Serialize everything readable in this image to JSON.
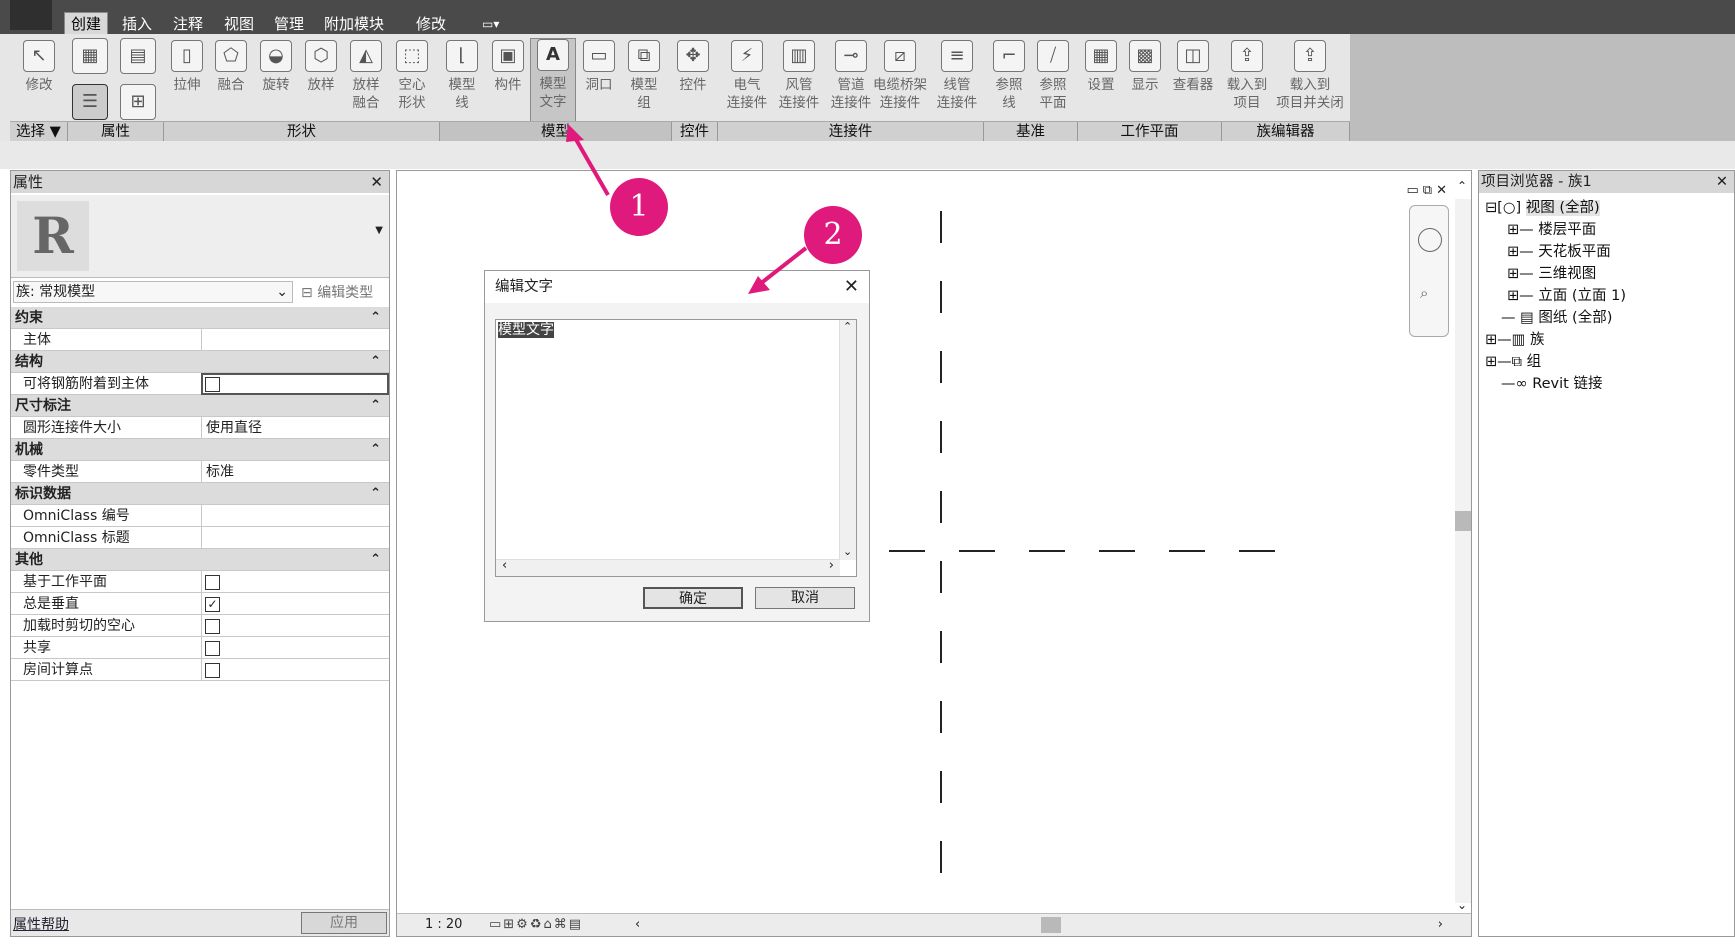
{
  "tabs": [
    "创建",
    "插入",
    "注释",
    "视图",
    "管理",
    "附加模块",
    "修改"
  ],
  "ribbon": {
    "tools": [
      {
        "label": "修改",
        "icon": "cursor-icon"
      },
      {
        "label": "拉伸",
        "icon": "extrude-icon"
      },
      {
        "label": "融合",
        "icon": "blend-icon"
      },
      {
        "label": "旋转",
        "icon": "revolve-icon"
      },
      {
        "label": "放样",
        "icon": "sweep-icon"
      },
      {
        "label": "放样\n融合",
        "icon": "swept-blend-icon"
      },
      {
        "label": "空心\n形状",
        "icon": "void-icon"
      },
      {
        "label": "模型\n线",
        "icon": "model-line-icon"
      },
      {
        "label": "构件",
        "icon": "component-icon"
      },
      {
        "label": "模型\n文字",
        "icon": "model-text-icon"
      },
      {
        "label": "洞口",
        "icon": "opening-icon"
      },
      {
        "label": "模型\n组",
        "icon": "model-group-icon"
      },
      {
        "label": "控件",
        "icon": "control-icon"
      },
      {
        "label": "电气\n连接件",
        "icon": "electrical-connector-icon"
      },
      {
        "label": "风管\n连接件",
        "icon": "duct-connector-icon"
      },
      {
        "label": "管道\n连接件",
        "icon": "pipe-connector-icon"
      },
      {
        "label": "电缆桥架\n连接件",
        "icon": "cable-tray-connector-icon"
      },
      {
        "label": "线管\n连接件",
        "icon": "conduit-connector-icon"
      },
      {
        "label": "参照\n线",
        "icon": "reference-line-icon"
      },
      {
        "label": "参照\n平面",
        "icon": "reference-plane-icon"
      },
      {
        "label": "设置",
        "icon": "set-workplane-icon"
      },
      {
        "label": "显示",
        "icon": "show-workplane-icon"
      },
      {
        "label": "查看器",
        "icon": "viewer-icon"
      },
      {
        "label": "载入到\n项目",
        "icon": "load-into-project-icon"
      },
      {
        "label": "载入到\n项目并关闭",
        "icon": "load-and-close-icon"
      }
    ],
    "panels": [
      "选择 ▼",
      "属性",
      "形状",
      "模型",
      "控件",
      "连接件",
      "基准",
      "工作平面",
      "族编辑器"
    ]
  },
  "properties": {
    "title": "属性",
    "family": "族: 常规模型",
    "edit_type": "编辑类型",
    "groups": [
      {
        "name": "约束",
        "rows": [
          {
            "k": "主体",
            "v": ""
          }
        ]
      },
      {
        "name": "结构",
        "rows": [
          {
            "k": "可将钢筋附着到主体",
            "cb": false
          }
        ]
      },
      {
        "name": "尺寸标注",
        "rows": [
          {
            "k": "圆形连接件大小",
            "v": "使用直径"
          }
        ]
      },
      {
        "name": "机械",
        "rows": [
          {
            "k": "零件类型",
            "v": "标准"
          }
        ]
      },
      {
        "name": "标识数据",
        "rows": [
          {
            "k": "OmniClass 编号",
            "v": ""
          },
          {
            "k": "OmniClass 标题",
            "v": ""
          }
        ]
      },
      {
        "name": "其他",
        "rows": [
          {
            "k": "基于工作平面",
            "cb": false
          },
          {
            "k": "总是垂直",
            "cb": true
          },
          {
            "k": "加载时剪切的空心",
            "cb": false
          },
          {
            "k": "共享",
            "cb": false
          },
          {
            "k": "房间计算点",
            "cb": false
          }
        ]
      }
    ],
    "help": "属性帮助",
    "apply": "应用"
  },
  "dialog": {
    "title": "编辑文字",
    "text": "模型文字",
    "ok": "确定",
    "cancel": "取消"
  },
  "statusbar": {
    "scale": "1 : 20"
  },
  "browser": {
    "title": "项目浏览器 - 族1",
    "items": [
      {
        "label": "视图 (全部)",
        "level": 0
      },
      {
        "label": "楼层平面",
        "level": 1
      },
      {
        "label": "天花板平面",
        "level": 1
      },
      {
        "label": "三维视图",
        "level": 1
      },
      {
        "label": "立面 (立面 1)",
        "level": 1
      },
      {
        "label": "图纸 (全部)",
        "level": 0
      },
      {
        "label": "族",
        "level": 0
      },
      {
        "label": "组",
        "level": 0
      },
      {
        "label": "Revit 链接",
        "level": 0
      }
    ]
  },
  "callouts": [
    "1",
    "2"
  ],
  "colors": {
    "callout": "#e0197d",
    "tabbar": "#4a4a4a"
  }
}
